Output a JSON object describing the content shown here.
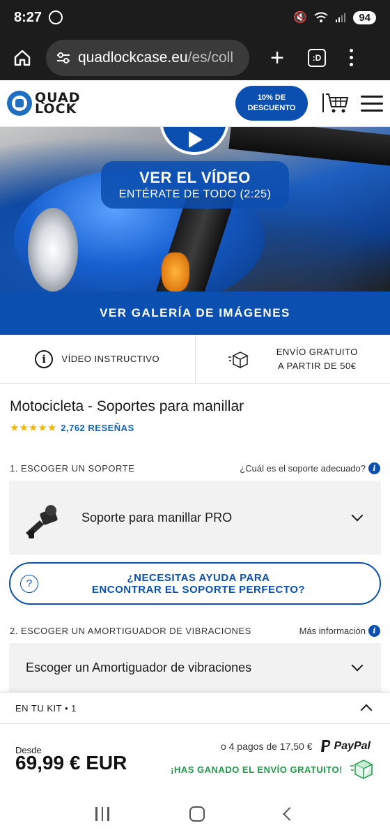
{
  "status_bar": {
    "time": "8:27",
    "battery": "94"
  },
  "browser": {
    "url_host": "quadlockcase.eu",
    "url_path": "/es/coll",
    "tab_label": ":D"
  },
  "header": {
    "logo_line1": "QUAD",
    "logo_line2": "LOCK",
    "discount_line1": "10% DE",
    "discount_line2": "DESCUENTO"
  },
  "hero": {
    "video_title": "VER EL VÍDEO",
    "video_subtitle": "ENTÉRATE DE TODO (2:25)"
  },
  "gallery_button": "VER GALERÍA DE IMÁGENES",
  "info_row": {
    "video_label": "VÍDEO INSTRUCTIVO",
    "shipping_line1": "ENVÍO GRATUITO",
    "shipping_line2": "A PARTIR DE 50€"
  },
  "product": {
    "title": "Motocicleta - Soportes para manillar",
    "stars": "★★★★★",
    "reviews": "2,762 RESEÑAS"
  },
  "step1": {
    "label": "1. ESCOGER UN SOPORTE",
    "help": "¿Cuál es el soporte adecuado?",
    "selected": "Soporte para manillar PRO"
  },
  "help_pill": {
    "line1": "¿NECESITAS AYUDA PARA",
    "line2": "ENCONTRAR EL SOPORTE PERFECTO?"
  },
  "step2": {
    "label": "2. ESCOGER UN AMORTIGUADOR DE VIBRACIONES",
    "help": "Más información",
    "selected": "Escoger un Amortiguador de vibraciones"
  },
  "kit": {
    "label": "EN TU KIT • 1"
  },
  "pricing": {
    "from_label": "Desde",
    "price": "69,99 € EUR",
    "installments": "o 4 pagos de 17,50 €",
    "paypal": "PayPal",
    "free_shipping": "¡HAS GANADO EL ENVÍO GRATUITO!"
  },
  "colors": {
    "brand_blue": "#0b4fb0",
    "success_green": "#1f9a4a",
    "star_gold": "#f2b705"
  }
}
